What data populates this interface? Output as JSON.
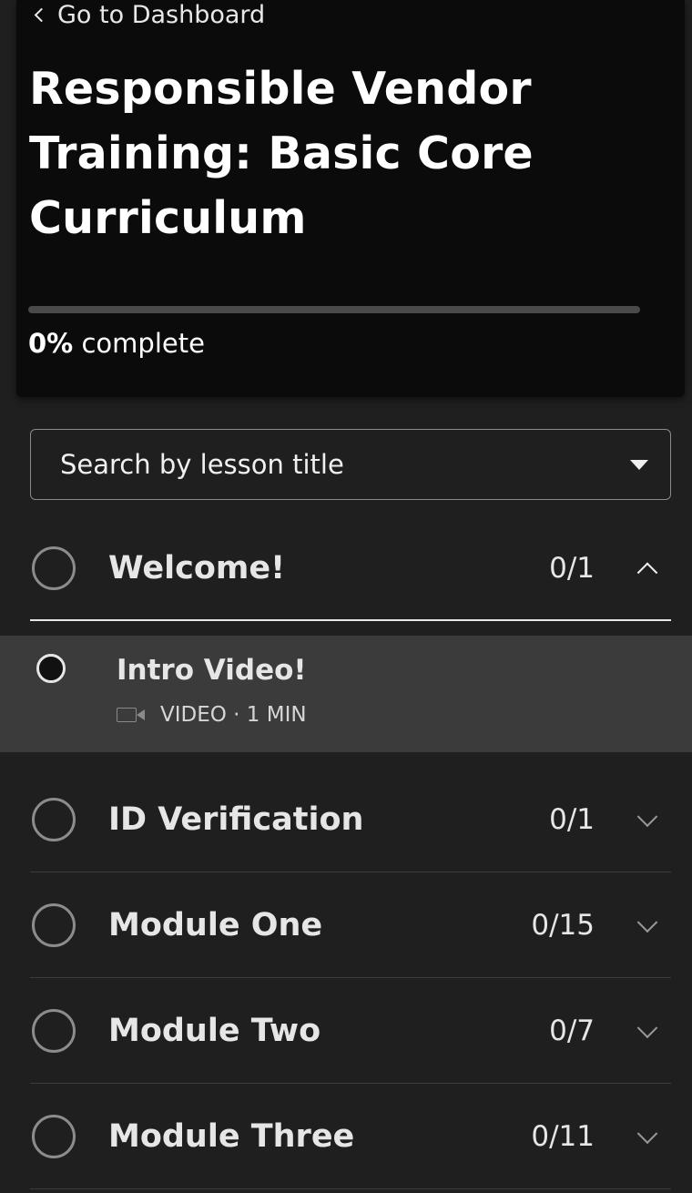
{
  "header": {
    "back_link": "Go to Dashboard",
    "course_title": "Responsible Vendor Training: Basic Core Curriculum",
    "progress_percent": 0,
    "progress_value": "0%",
    "progress_suffix": "complete"
  },
  "search": {
    "placeholder": "Search by lesson title"
  },
  "sections": [
    {
      "title": "Welcome!",
      "count": "0/1",
      "expanded": true,
      "lessons": [
        {
          "title": "Intro Video!",
          "type": "VIDEO",
          "duration": "1 MIN",
          "meta": "VIDEO · 1 MIN"
        }
      ]
    },
    {
      "title": "ID Verification",
      "count": "0/1",
      "expanded": false
    },
    {
      "title": "Module One",
      "count": "0/15",
      "expanded": false
    },
    {
      "title": "Module Two",
      "count": "0/7",
      "expanded": false
    },
    {
      "title": "Module Three",
      "count": "0/11",
      "expanded": false
    }
  ],
  "colors": {
    "background": "#1f1f1f",
    "header_background": "#0b0b0b",
    "active_lesson_background": "#3b3b3b",
    "text": "#e6e6e6"
  }
}
